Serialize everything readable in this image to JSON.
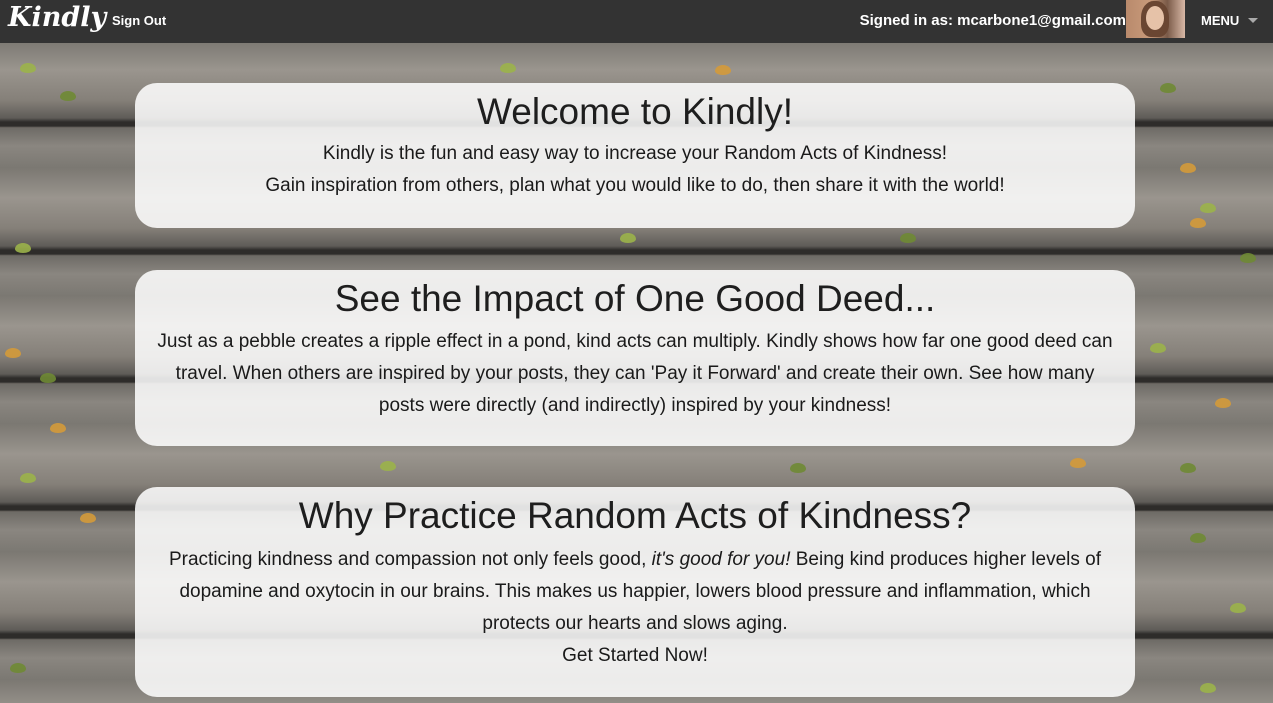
{
  "topbar": {
    "logo": "Kindly",
    "sign_out": "Sign Out",
    "signed_in_label": "Signed in as: mcarbone1@gmail.com",
    "menu_label": "MENU"
  },
  "cards": [
    {
      "title": "Welcome to Kindly!",
      "lines": [
        "Kindly is the fun and easy way to increase your Random Acts of Kindness!",
        "Gain inspiration from others, plan what you would like to do, then share it with the world!"
      ]
    },
    {
      "title": "See the Impact of One Good Deed...",
      "body": "Just as a pebble creates a ripple effect in a pond, kind acts can multiply. Kindly shows how far one good deed can travel. When others are inspired by your posts, they can 'Pay it Forward' and create their own. See how many posts were directly (and indirectly) inspired by your kindness!"
    },
    {
      "title": "Why Practice Random Acts of Kindness?",
      "body_before": "Practicing kindness and compassion not only feels good, ",
      "body_emphasis": "it's good for you!",
      "body_after": " Being kind produces higher levels of dopamine and oxytocin in our brains. This makes us happier, lowers blood pressure and inflammation, which protects our hearts and slows aging.",
      "cta": "Get Started Now!"
    }
  ],
  "colors": {
    "topbar_bg": "#333333",
    "card_bg": "rgba(255,255,255,0.86)"
  }
}
